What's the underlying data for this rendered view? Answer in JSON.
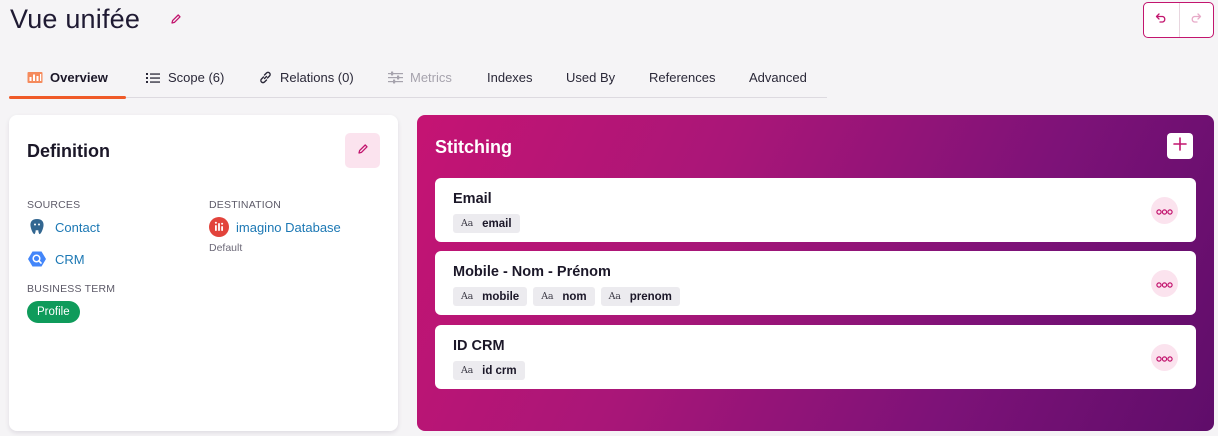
{
  "header": {
    "title": "Vue unifée",
    "icons": {
      "edit": "pencil-icon",
      "undo": "undo-arrow-icon",
      "redo": "redo-arrow-icon"
    }
  },
  "tabs": [
    {
      "label": "Overview",
      "icon": "overview-chart-icon",
      "active": true
    },
    {
      "label": "Scope (6)",
      "icon": "list-icon"
    },
    {
      "label": "Relations (0)",
      "icon": "link-icon"
    },
    {
      "label": "Metrics",
      "icon": "sliders-icon",
      "disabled": true
    },
    {
      "label": "Indexes"
    },
    {
      "label": "Used By"
    },
    {
      "label": "References"
    },
    {
      "label": "Advanced"
    }
  ],
  "definition": {
    "title": "Definition",
    "sources_label": "SOURCES",
    "sources": [
      {
        "name": "Contact",
        "icon": "postgresql-icon"
      },
      {
        "name": "CRM",
        "icon": "bigquery-icon"
      }
    ],
    "destination_label": "DESTINATION",
    "destination": {
      "name": "imagino Database",
      "sub": "Default",
      "icon": "imagino-icon"
    },
    "business_term_label": "BUSINESS TERM",
    "business_term": "Profile"
  },
  "stitching": {
    "title": "Stitching",
    "rules": [
      {
        "name": "Email",
        "fields": [
          "email"
        ]
      },
      {
        "name": "Mobile - Nom - Prénom",
        "fields": [
          "mobile",
          "nom",
          "prenom"
        ]
      },
      {
        "name": "ID CRM",
        "fields": [
          "id crm"
        ]
      }
    ],
    "chip_icon_text": "Aa"
  },
  "colors": {
    "accent": "#c2156e",
    "tab_underline": "#ef5a28",
    "link": "#1c78b4",
    "badge_green": "#0f9b5b",
    "stitch_gradient_start": "#c51473",
    "stitch_gradient_end": "#5f0d6a"
  }
}
